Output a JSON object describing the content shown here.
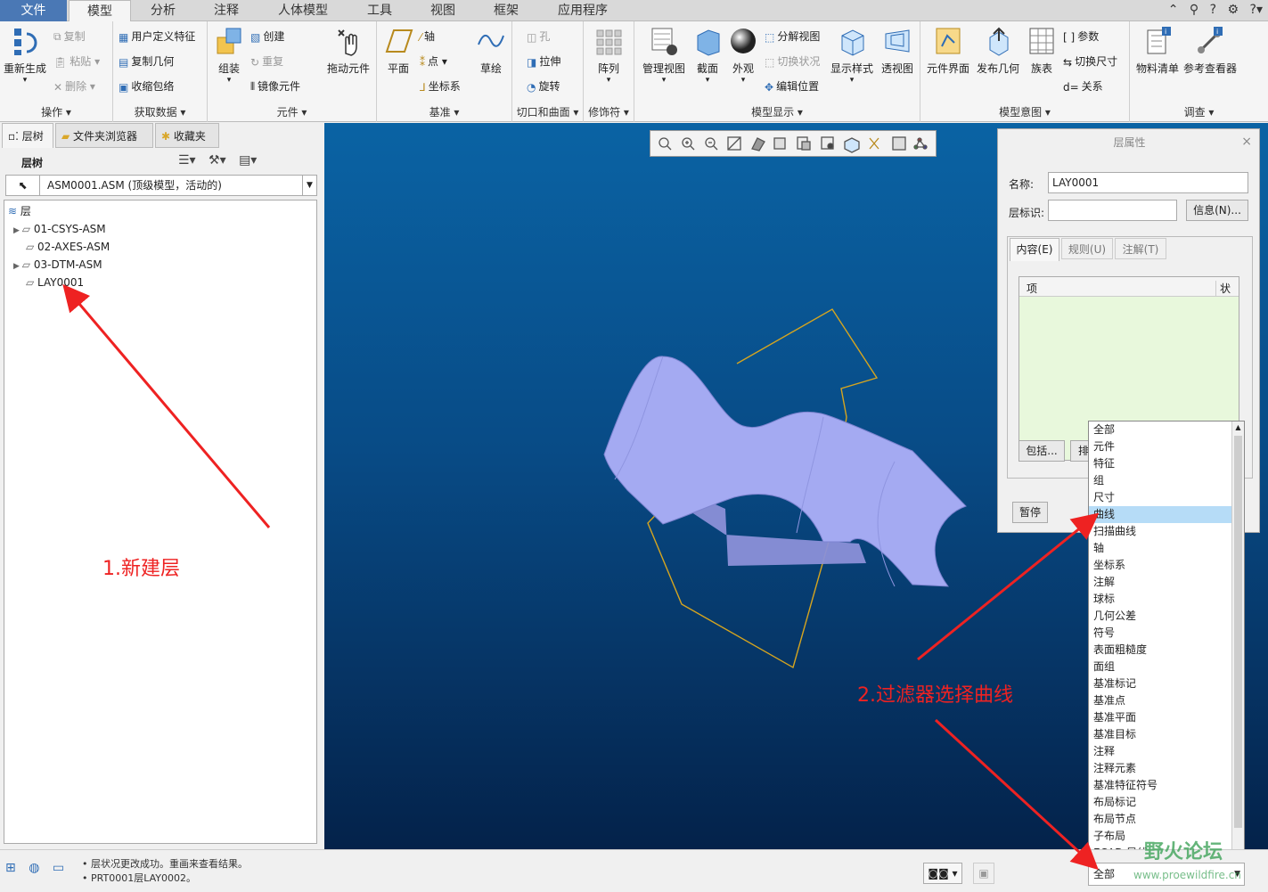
{
  "menu_tabs": [
    "文件",
    "模型",
    "分析",
    "注释",
    "人体模型",
    "工具",
    "视图",
    "框架",
    "应用程序"
  ],
  "ribbon": {
    "ops": {
      "regen": "重新生成",
      "copy": "复制",
      "paste": "粘贴",
      "delete": "删除",
      "label": "操作"
    },
    "get": {
      "udf": "用户定义特征",
      "copy_geom": "复制几何",
      "shrinkwrap": "收缩包络",
      "label": "获取数据"
    },
    "comp": {
      "assemble": "组装",
      "create": "创建",
      "repeat": "重复",
      "mirror": "镜像元件",
      "drag": "拖动元件",
      "label": "元件"
    },
    "datum": {
      "plane": "平面",
      "axis": "轴",
      "point": "点",
      "csys": "坐标系",
      "sketch": "草绘",
      "label": "基准"
    },
    "cut": {
      "hole": "孔",
      "extrude": "拉伸",
      "revolve": "旋转",
      "label": "切口和曲面"
    },
    "mod": {
      "pattern": "阵列",
      "label": "修饰符"
    },
    "display": {
      "manage": "管理视图",
      "section": "截面",
      "appearance": "外观",
      "explode": "分解视图",
      "toggle": "切换状况",
      "edit_pos": "编辑位置",
      "style": "显示样式",
      "perspective": "透视图",
      "label": "模型显示"
    },
    "intent": {
      "comp_iface": "元件界面",
      "publish": "发布几何",
      "family": "族表",
      "param": "参数",
      "switch_dim": "切换尺寸",
      "relation": "关系",
      "label": "模型意图"
    },
    "invest": {
      "bom": "物料清单",
      "ref_viewer": "参考查看器",
      "label": "调查"
    }
  },
  "left_panel": {
    "tabs": [
      "层树",
      "文件夹浏览器",
      "收藏夹"
    ],
    "title": "层树",
    "model_select": "ASM0001.ASM (顶级模型，活动的)",
    "root": "层",
    "layers": [
      "01-CSYS-ASM",
      "02-AXES-ASM",
      "03-DTM-ASM",
      "LAY0001"
    ]
  },
  "dialog": {
    "title": "层属性",
    "name_label": "名称:",
    "name_value": "LAY0001",
    "id_label": "层标识:",
    "id_value": "",
    "info_btn": "信息(N)...",
    "tabs": [
      "内容(E)",
      "规则(U)",
      "注解(T)"
    ],
    "col_item": "项",
    "col_status": "状",
    "include_btn": "包括...",
    "exclude_btn": "排",
    "pause_btn": "暂停"
  },
  "filter_options": [
    "全部",
    "元件",
    "特征",
    "组",
    "尺寸",
    "曲线",
    "扫描曲线",
    "轴",
    "坐标系",
    "注解",
    "球标",
    "几何公差",
    "符号",
    "表面粗糙度",
    "面组",
    "基准标记",
    "基准点",
    "基准平面",
    "基准目标",
    "注释",
    "注释元素",
    "基准特征符号",
    "布局标记",
    "布局节点",
    "子布局",
    "ECAD 导线"
  ],
  "filter_selected": "曲线",
  "filter_current": "全部",
  "status": {
    "line1": "层状况更改成功。重画来查看结果。",
    "line2": "PRT0001层LAY0002。"
  },
  "annotations": {
    "a1": "1.新建层",
    "a2": "2.过滤器选择曲线"
  },
  "watermark": {
    "text": "野火论坛",
    "url": "www.proewildfire.cn"
  }
}
